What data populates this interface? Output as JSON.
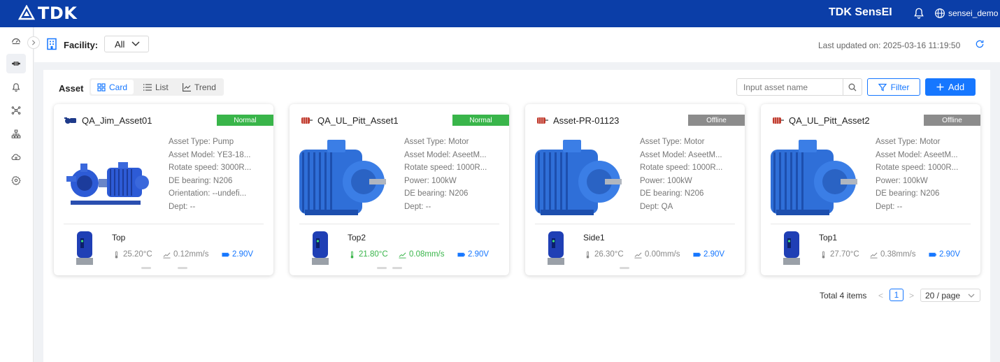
{
  "header": {
    "logo_text": "TDK",
    "app_title": "TDK SensEI",
    "user": "sensei_demo",
    "color": "#0b3ea8"
  },
  "sidebar": {
    "items": [
      {
        "icon": "dashboard-icon"
      },
      {
        "icon": "asset-icon",
        "active": true
      },
      {
        "icon": "bell-icon"
      },
      {
        "icon": "network-icon"
      },
      {
        "icon": "hierarchy-icon"
      },
      {
        "icon": "cloud-icon"
      },
      {
        "icon": "gear-icon"
      }
    ]
  },
  "facility": {
    "label": "Facility:",
    "selected": "All",
    "last_updated": "Last updated on: 2025-03-16 11:19:50"
  },
  "toolbar": {
    "title": "Asset",
    "tabs": [
      {
        "label": "Card",
        "active": true
      },
      {
        "label": "List"
      },
      {
        "label": "Trend"
      }
    ],
    "search_placeholder": "Input asset name",
    "filter_label": "Filter",
    "add_label": "Add"
  },
  "cards": [
    {
      "name": "QA_Jim_Asset01",
      "status": "Normal",
      "props": [
        "Asset Type:  Pump",
        "Asset Model:  YE3-18...",
        "Rotate speed:  3000R...",
        "DE bearing:  N206",
        "Orientation:  --undefi...",
        "Dept:  --"
      ],
      "sensor": "Top",
      "temp": "25.20°C",
      "vibration": "0.12mm/s",
      "voltage": "2.90V",
      "metric_color": "grey"
    },
    {
      "name": "QA_UL_Pitt_Asset1",
      "status": "Normal",
      "props": [
        "Asset Type:  Motor",
        "Asset Model:  AseetM...",
        "Rotate speed:  1000R...",
        "Power:  100kW",
        "DE bearing:  N206",
        "Dept:  --"
      ],
      "sensor": "Top2",
      "temp": "21.80°C",
      "vibration": "0.08mm/s",
      "voltage": "2.90V",
      "metric_color": "green"
    },
    {
      "name": "Asset-PR-01123",
      "status": "Offline",
      "props": [
        "Asset Type:  Motor",
        "Asset Model:  AseetM...",
        "Rotate speed:  1000R...",
        "Power:  100kW",
        "DE bearing:  N206",
        "Dept:  QA"
      ],
      "sensor": "Side1",
      "temp": "26.30°C",
      "vibration": "0.00mm/s",
      "voltage": "2.90V",
      "metric_color": "grey"
    },
    {
      "name": "QA_UL_Pitt_Asset2",
      "status": "Offline",
      "props": [
        "Asset Type:  Motor",
        "Asset Model:  AseetM...",
        "Rotate speed:  1000R...",
        "Power:  100kW",
        "DE bearing:  N206",
        "Dept:  --"
      ],
      "sensor": "Top1",
      "temp": "27.70°C",
      "vibration": "0.38mm/s",
      "voltage": "2.90V",
      "metric_color": "grey"
    }
  ],
  "pagination": {
    "total": "Total 4 items",
    "prev": "<",
    "current": "1",
    "next": ">",
    "page_size": "20 / page"
  }
}
